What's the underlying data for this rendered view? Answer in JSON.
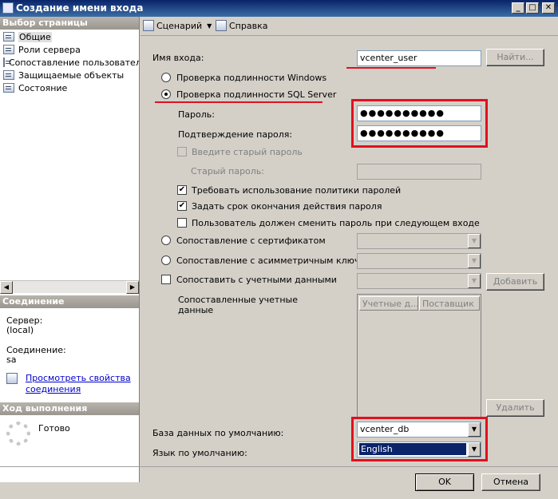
{
  "window": {
    "title": "Создание имени входа"
  },
  "left": {
    "page_select_header": "Выбор страницы",
    "pages": [
      "Общие",
      "Роли сервера",
      "Сопоставление пользователей",
      "Защищаемые объекты",
      "Состояние"
    ],
    "connection_header": "Соединение",
    "server_label": "Сервер:",
    "server_value": "(local)",
    "connection_label": "Соединение:",
    "connection_value": "sa",
    "view_props_line1": "Просмотреть свойства",
    "view_props_line2": "соединения",
    "progress_header": "Ход выполнения",
    "progress_status": "Готово"
  },
  "toolbar": {
    "script": "Сценарий",
    "help": "Справка"
  },
  "form": {
    "login_label": "Имя входа:",
    "login_value": "vcenter_user",
    "find_button": "Найти...",
    "windows_auth": "Проверка подлинности Windows",
    "sql_auth": "Проверка подлинности SQL Server",
    "password_label": "Пароль:",
    "password_value": "●●●●●●●●●●",
    "confirm_label": "Подтверждение пароля:",
    "confirm_value": "●●●●●●●●●●",
    "old_password_check": "Введите старый пароль",
    "old_password_label": "Старый пароль:",
    "enforce_policy": "Требовать использование политики паролей",
    "enforce_expiration": "Задать срок окончания действия пароля",
    "must_change": "Пользователь должен сменить пароль при следующем входе",
    "cert_map": "Сопоставление с сертификатом",
    "asym_key_map": "Сопоставление с асимметричным ключом",
    "cred_map": "Сопоставить с учетными данными",
    "add_button": "Добавить",
    "mapped_creds_line1": "Сопоставленные учетные",
    "mapped_creds_line2": "данные",
    "col_creds": "Учетные д...",
    "col_provider": "Поставщик",
    "remove_button": "Удалить",
    "default_db_label": "База данных по умолчанию:",
    "default_db_value": "vcenter_db",
    "default_lang_label": "Язык по умолчанию:",
    "default_lang_value": "English"
  },
  "buttons": {
    "ok": "OK",
    "cancel": "Отмена"
  },
  "colors": {
    "highlight": "#e01020",
    "selection": "#0a246a"
  }
}
